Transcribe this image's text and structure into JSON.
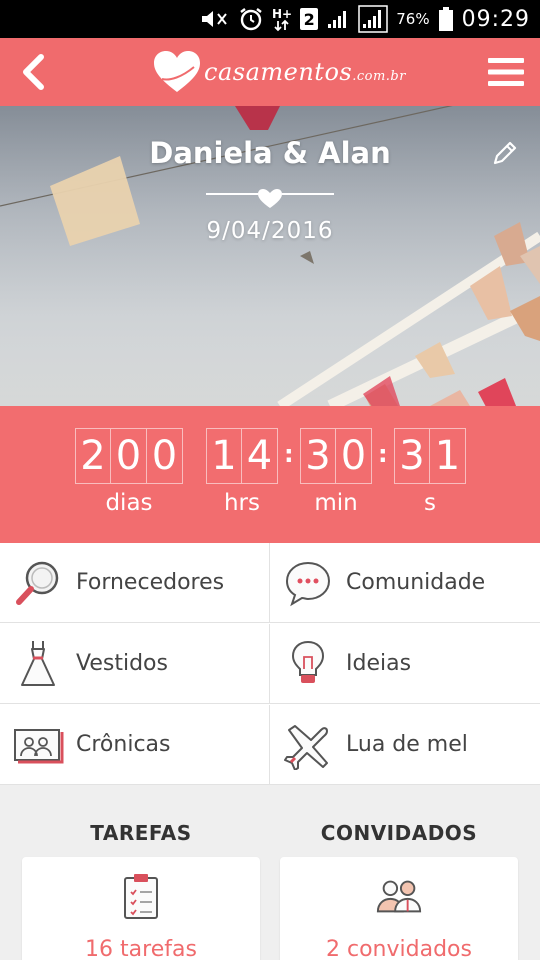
{
  "status_bar": {
    "sim_slot": "2",
    "battery_pct": "76%",
    "time": "09:29",
    "icons": [
      "mute-icon",
      "alarm-icon",
      "data-hplus-icon",
      "signal-icon",
      "battery-icon"
    ]
  },
  "app_bar": {
    "logo_text": "casamentos",
    "logo_suffix": ".com.br",
    "back_icon": "chevron-left-icon",
    "menu_icon": "hamburger-menu-icon",
    "color": "#f06b6d"
  },
  "hero": {
    "couple": "Daniela & Alan",
    "date": "9/04/2016",
    "edit_icon": "pencil-icon"
  },
  "countdown": {
    "days": "200",
    "hours": "14",
    "minutes": "30",
    "seconds": "31",
    "labels": {
      "days": "dias",
      "hours": "hrs",
      "minutes": "min",
      "seconds": "s"
    }
  },
  "menu": [
    {
      "label": "Fornecedores",
      "icon": "magnifier-icon"
    },
    {
      "label": "Comunidade",
      "icon": "speech-bubble-icon"
    },
    {
      "label": "Vestidos",
      "icon": "dress-icon"
    },
    {
      "label": "Ideias",
      "icon": "lightbulb-icon"
    },
    {
      "label": "Crônicas",
      "icon": "photo-album-icon"
    },
    {
      "label": "Lua de mel",
      "icon": "airplane-icon"
    }
  ],
  "sections": {
    "tasks": {
      "title": "TAREFAS",
      "value": "16 tarefas",
      "icon": "clipboard-icon"
    },
    "guests": {
      "title": "CONVIDADOS",
      "value": "2 convidados",
      "icon": "guests-icon"
    }
  },
  "colors": {
    "accent": "#f06b6d",
    "countdown_bg": "#f26d6f"
  }
}
